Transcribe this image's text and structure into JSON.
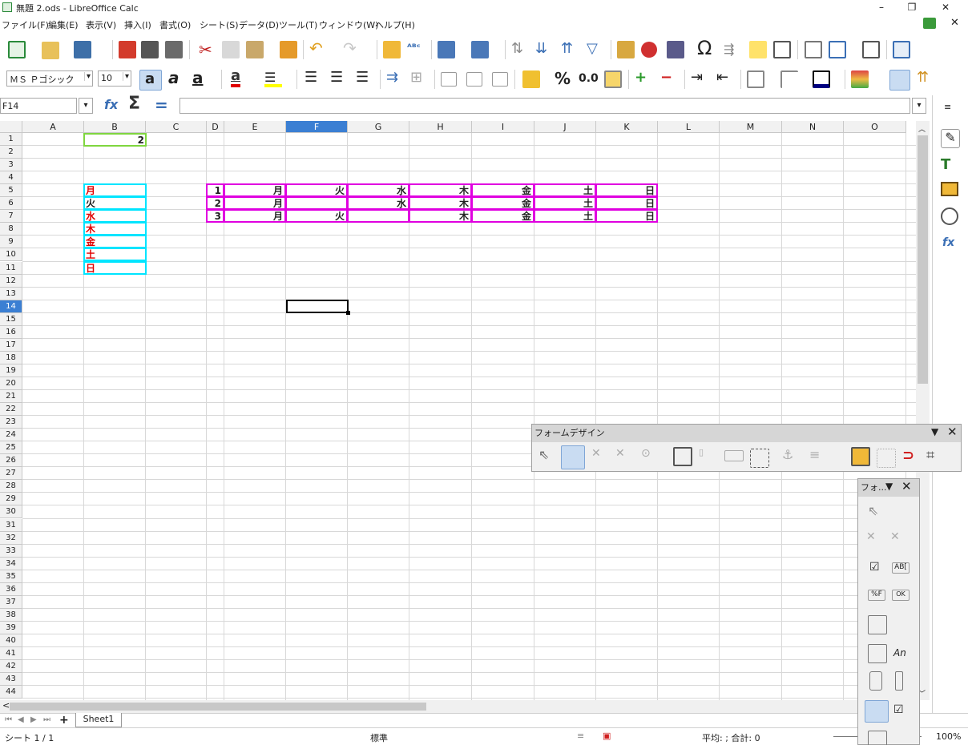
{
  "window": {
    "title": "無題 2.ods - LibreOffice Calc",
    "minimize": "–",
    "maximize": "❐",
    "close": "✕"
  },
  "menu": [
    "ファイル(F)",
    "編集(E)",
    "表示(V)",
    "挿入(I)",
    "書式(O)",
    "シート(S)",
    "データ(D)",
    "ツール(T)",
    "ウィンドウ(W)",
    "ヘルプ(H)"
  ],
  "toolbar": {
    "font_name": "ＭＳ Ｐゴシック",
    "font_size": "10",
    "percent": "%",
    "decimal": "0.0"
  },
  "formula": {
    "cell_ref": "F14",
    "sigma": "Σ",
    "equals": "=",
    "content": ""
  },
  "columns": [
    "A",
    "B",
    "C",
    "D",
    "E",
    "F",
    "G",
    "H",
    "I",
    "J",
    "K",
    "L",
    "M",
    "N",
    "O"
  ],
  "rows": [
    "1",
    "2",
    "3",
    "4",
    "5",
    "6",
    "7",
    "8",
    "9",
    "10",
    "11",
    "12",
    "13",
    "14",
    "15",
    "16",
    "17",
    "18",
    "19",
    "20",
    "21",
    "22",
    "23",
    "24",
    "25",
    "26",
    "27",
    "28",
    "29",
    "30",
    "31",
    "32",
    "33",
    "34",
    "35",
    "36",
    "37",
    "38",
    "39",
    "40",
    "41",
    "42",
    "43",
    "44"
  ],
  "cells": {
    "b1": "2",
    "b_col": [
      "月",
      "火",
      "水",
      "木",
      "金",
      "土",
      "日"
    ],
    "table": [
      [
        "1",
        "月",
        "火",
        "水",
        "木",
        "金",
        "土",
        "日"
      ],
      [
        "2",
        "月",
        "",
        "水",
        "木",
        "金",
        "土",
        "日"
      ],
      [
        "3",
        "月",
        "火",
        "",
        "木",
        "金",
        "土",
        "日"
      ]
    ]
  },
  "form_design": {
    "title": "フォームデザイン",
    "menu_glyph": "▼",
    "close": "✕"
  },
  "form_controls": {
    "title": "フォ...",
    "menu_glyph": "▼",
    "close": "✕",
    "abc": "AB[",
    "fmt": "%F",
    "ok": "OK",
    "an": "An"
  },
  "tabs": {
    "sheet": "Sheet1",
    "add": "+"
  },
  "status": {
    "sheet": "シート 1 / 1",
    "style": "標準",
    "summary": "平均: ; 合計: 0",
    "zoom": "100%"
  },
  "colors": {
    "cyan": "#00e5ff",
    "magenta": "#e000e0",
    "green": "#7fd63f",
    "red": "#e00000",
    "select": "#3b7fd3"
  }
}
